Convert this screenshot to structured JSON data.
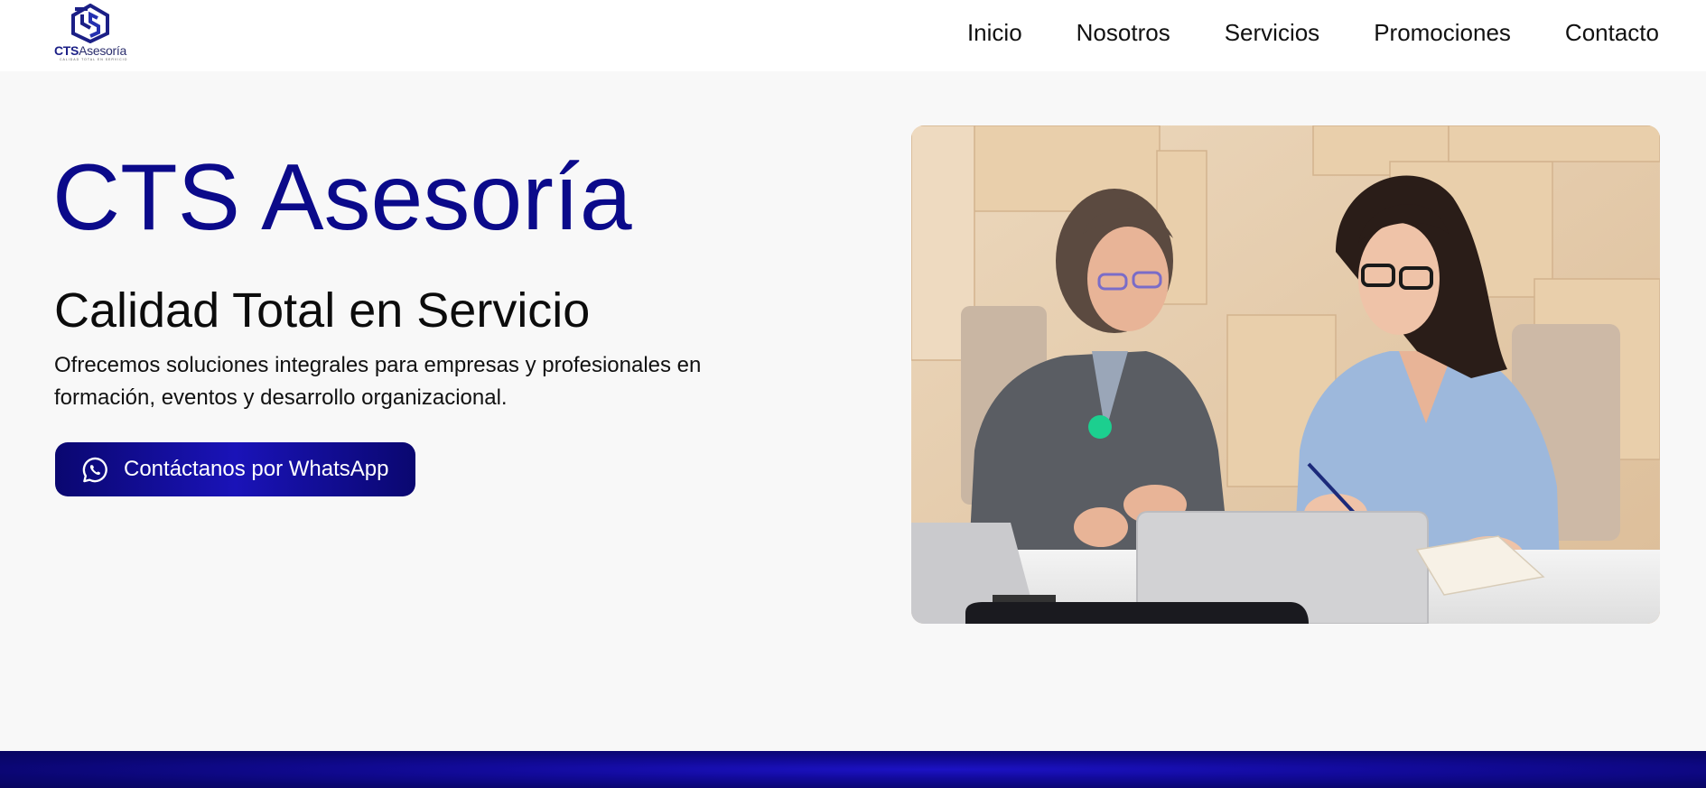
{
  "header": {
    "logo": {
      "brand_bold": "CTS",
      "brand_rest": "Asesoría",
      "tagline": "CALIDAD TOTAL EN SERVICIO",
      "icon": "cts-logo-icon"
    },
    "nav": [
      {
        "label": "Inicio"
      },
      {
        "label": "Nosotros"
      },
      {
        "label": "Servicios"
      },
      {
        "label": "Promociones"
      },
      {
        "label": "Contacto"
      }
    ]
  },
  "hero": {
    "title": "CTS Asesoría",
    "subtitle": "Calidad Total en Servicio",
    "description": "Ofrecemos soluciones integrales para empresas y profesionales en formación, eventos y desarrollo organizacional.",
    "cta": {
      "label": "Contáctanos por WhatsApp",
      "icon": "whatsapp-icon"
    },
    "image": {
      "name": "hero-photo"
    }
  },
  "colors": {
    "brand_blue": "#0b0a8a",
    "button_gradient_dark": "#0a0770",
    "button_gradient_light": "#1a13b8",
    "page_background": "#f8f8f8",
    "accent_dot": "#1ccf8f"
  }
}
